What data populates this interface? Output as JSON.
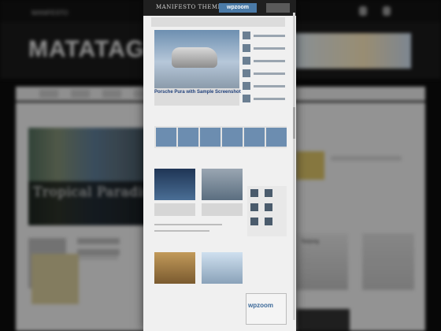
{
  "background_site": {
    "top_bar_text": "MANIFESTO",
    "logo_text": "MATATAG",
    "feature_title": "Tropical Paradise",
    "news_block_1_label": "Tanjung",
    "news_block_2_label": "",
    "nav_tabs": [
      "",
      "",
      "",
      "",
      ""
    ]
  },
  "device": {
    "brand": "MANIFESTO THEME",
    "badge": "wpzoom",
    "hero_title": "Porsche Pura with Sample Screenshot",
    "ad_label": "wpzoom"
  },
  "colors": {
    "accent_blue": "#4a7aa7",
    "background_dark": "#0b0b0b",
    "content_light": "#ebebeb"
  }
}
